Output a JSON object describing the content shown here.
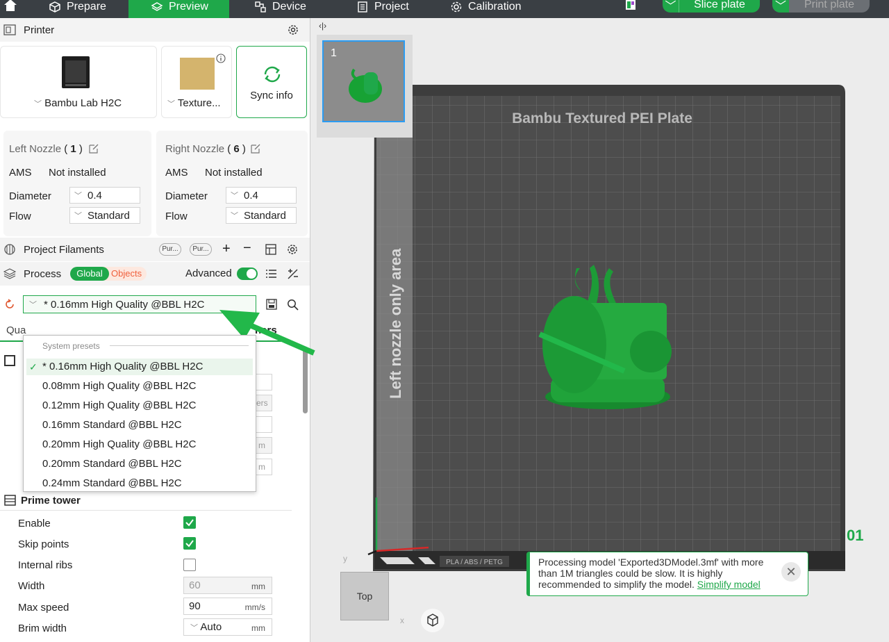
{
  "topbar": {
    "tabs": [
      {
        "label": "Prepare",
        "icon": "cube-icon"
      },
      {
        "label": "Preview",
        "icon": "layers-icon"
      },
      {
        "label": "Device",
        "icon": "device-icon"
      },
      {
        "label": "Project",
        "icon": "project-icon"
      },
      {
        "label": "Calibration",
        "icon": "gear-icon"
      }
    ],
    "active_tab": "Preview",
    "slice_label": "Slice plate",
    "print_label": "Print plate",
    "accent": "#1fa84a"
  },
  "printer": {
    "title": "Printer",
    "printer_name": "Bambu Lab H2C",
    "plate_name": "Texture...",
    "sync_label": "Sync info"
  },
  "nozzles": {
    "left": {
      "title": "Left Nozzle",
      "num": "1",
      "ams_label": "AMS",
      "ams_value": "Not installed",
      "diameter_label": "Diameter",
      "diameter": "0.4",
      "flow_label": "Flow",
      "flow": "Standard"
    },
    "right": {
      "title": "Right Nozzle",
      "num": "6",
      "ams_label": "AMS",
      "ams_value": "Not installed",
      "diameter_label": "Diameter",
      "diameter": "0.4",
      "flow_label": "Flow",
      "flow": "Standard"
    }
  },
  "filaments": {
    "title": "Project Filaments",
    "chips": [
      "Pur...",
      "Pur..."
    ]
  },
  "process": {
    "title": "Process",
    "global_label": "Global",
    "objects_label": "Objects",
    "advanced_label": "Advanced",
    "preset": "* 0.16mm High Quality @BBL H2C"
  },
  "dropdown": {
    "header": "System presets",
    "items": [
      "* 0.16mm High Quality @BBL H2C",
      "0.08mm High Quality @BBL H2C",
      "0.12mm High Quality @BBL H2C",
      "0.16mm Standard @BBL H2C",
      "0.20mm High Quality @BBL H2C",
      "0.20mm Standard @BBL H2C",
      "0.24mm Standard @BBL H2C"
    ],
    "selected_index": 0
  },
  "hidden_behind": {
    "tab_partial": "Qua",
    "others_partial": "hers",
    "unit_ers": "ers",
    "unit_m1": "m",
    "unit_m2": "m"
  },
  "prime_tower": {
    "title": "Prime tower",
    "enable_label": "Enable",
    "enable": true,
    "skip_label": "Skip points",
    "skip": true,
    "ribs_label": "Internal ribs",
    "ribs": false,
    "width_label": "Width",
    "width": "60",
    "width_unit": "mm",
    "speed_label": "Max speed",
    "speed": "90",
    "speed_unit": "mm/s",
    "brim_label": "Brim width",
    "brim": "Auto",
    "brim_unit": "mm"
  },
  "viewport": {
    "plate_title": "Bambu Textured PEI Plate",
    "left_area_label": "Left nozzle only area",
    "plate_thumb_number": "1",
    "plate_number": "01",
    "plate_sticker": "PLA / ABS / PETG",
    "view_label": "Top",
    "axis_y": "y",
    "axis_x": "x"
  },
  "toast": {
    "message": "Processing model 'Exported3DModel.3mf' with more than 1M triangles could be slow. It is highly recommended to simplify the model.",
    "link": "Simplify model"
  }
}
